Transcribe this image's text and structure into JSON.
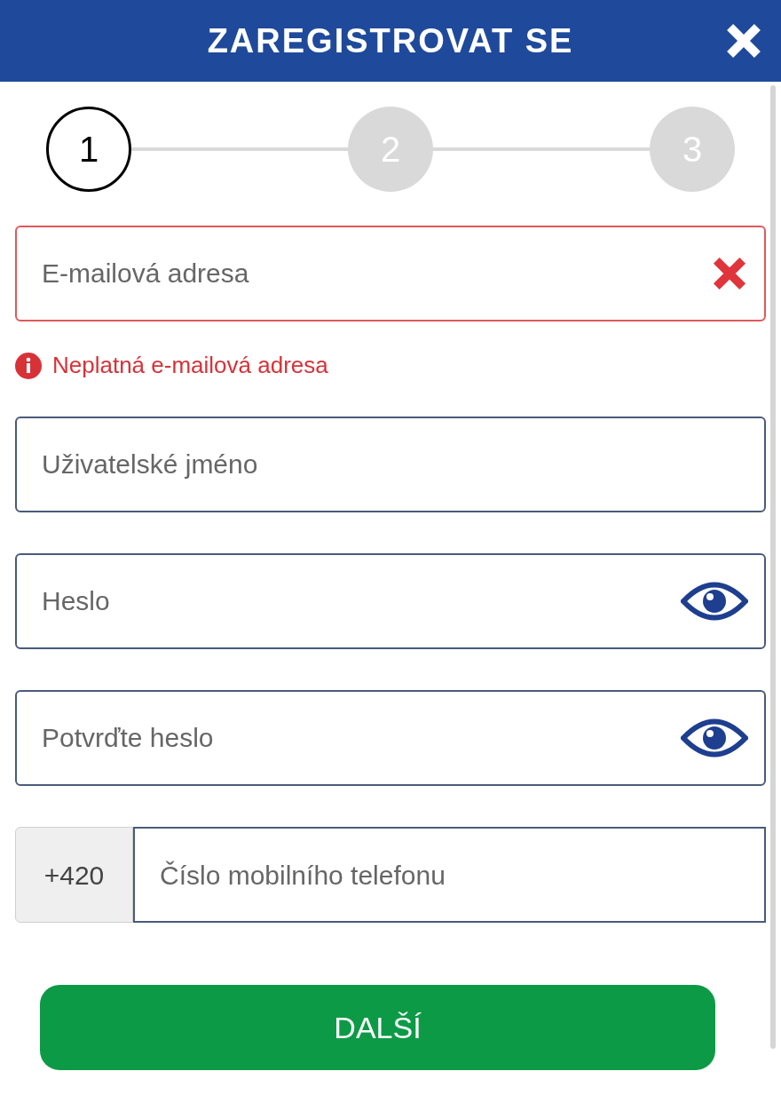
{
  "header": {
    "title": "ZAREGISTROVAT SE"
  },
  "steps": [
    {
      "label": "1",
      "selected": true
    },
    {
      "label": "2",
      "selected": false
    },
    {
      "label": "3",
      "selected": false
    }
  ],
  "fields": [
    {
      "kind": "email",
      "placeholder": "E-mailová adresa",
      "invalid": true,
      "error": "Neplatná e-mailová adresa"
    },
    {
      "kind": "text",
      "placeholder": "Uživatelské jméno",
      "invalid": false
    },
    {
      "kind": "password",
      "placeholder": "Heslo",
      "invalid": false
    },
    {
      "kind": "password",
      "placeholder": "Potvrďte heslo",
      "invalid": false
    },
    {
      "kind": "phone",
      "prefix": "+420",
      "placeholder": "Číslo mobilního telefonu",
      "invalid": false
    }
  ],
  "button": {
    "label": "DALŠÍ"
  }
}
